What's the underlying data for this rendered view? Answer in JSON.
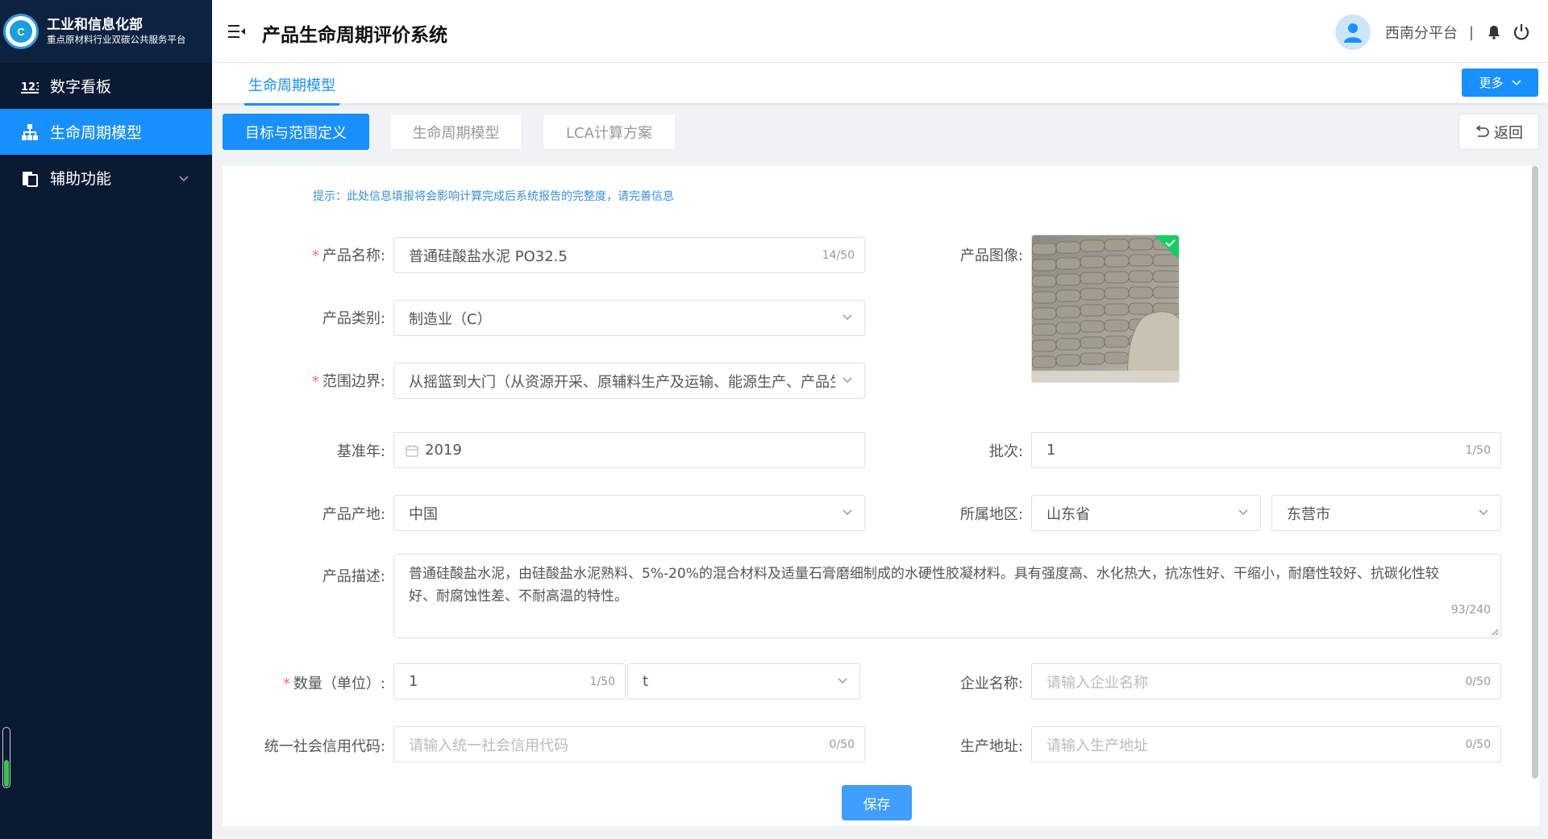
{
  "sidebar": {
    "brand_title": "工业和信息化部",
    "brand_subtitle": "重点原材料行业双碳公共服务平台",
    "logo_text": "C",
    "items": [
      {
        "label": "数字看板",
        "icon": "dashboard-123-icon"
      },
      {
        "label": "生命周期模型",
        "icon": "hierarchy-icon",
        "active": true
      },
      {
        "label": "辅助功能",
        "icon": "document-icon",
        "expandable": true
      }
    ],
    "slider_level": 0.45
  },
  "header": {
    "title": "产品生命周期评价系统",
    "username": "西南分平台",
    "separator": "|"
  },
  "tabs": {
    "main_tab": "生命周期模型",
    "more_label": "更多"
  },
  "steps": {
    "items": [
      "目标与范围定义",
      "生命周期模型",
      "LCA计算方案"
    ],
    "active_index": 0,
    "back_label": "返回"
  },
  "form": {
    "hint": "提示：此处信息填报将会影响计算完成后系统报告的完整度，请完善信息",
    "product_name": {
      "label": "产品名称:",
      "required": true,
      "value": "普通硅酸盐水泥 PO32.5",
      "count": "14/50"
    },
    "product_category": {
      "label": "产品类别:",
      "value": "制造业（C）"
    },
    "scope_boundary": {
      "label": "范围边界:",
      "required": true,
      "value": "从摇篮到大门（从资源开采、原辅料生产及运输、能源生产、产品生"
    },
    "base_year": {
      "label": "基准年:",
      "value": "2019"
    },
    "origin": {
      "label": "产品产地:",
      "value": "中国"
    },
    "description": {
      "label": "产品描述:",
      "value": "普通硅酸盐水泥，由硅酸盐水泥熟料、5%-20%的混合材料及适量石膏磨细制成的水硬性胶凝材料。具有强度高、水化热大，抗冻性好、干缩小，耐磨性较好、抗碳化性较好、耐腐蚀性差、不耐高温的特性。",
      "count": "93/240"
    },
    "quantity": {
      "label": "数量（单位）:",
      "required": true,
      "value": "1",
      "count": "1/50",
      "unit": "t"
    },
    "credit_code": {
      "label": "统一社会信用代码:",
      "placeholder": "请输入统一社会信用代码",
      "count": "0/50"
    },
    "product_image": {
      "label": "产品图像:"
    },
    "batch": {
      "label": "批次:",
      "value": "1",
      "count": "1/50"
    },
    "region": {
      "label": "所属地区:",
      "province": "山东省",
      "city": "东营市"
    },
    "company": {
      "label": "企业名称:",
      "placeholder": "请输入企业名称",
      "count": "0/50"
    },
    "address": {
      "label": "生产地址:",
      "placeholder": "请输入生产地址",
      "count": "0/50"
    },
    "save_label": "保存"
  },
  "colors": {
    "primary": "#1890ff",
    "sidebar_bg": "#0a1a33",
    "required": "#f56c6c",
    "hint": "#3b8fd6"
  }
}
